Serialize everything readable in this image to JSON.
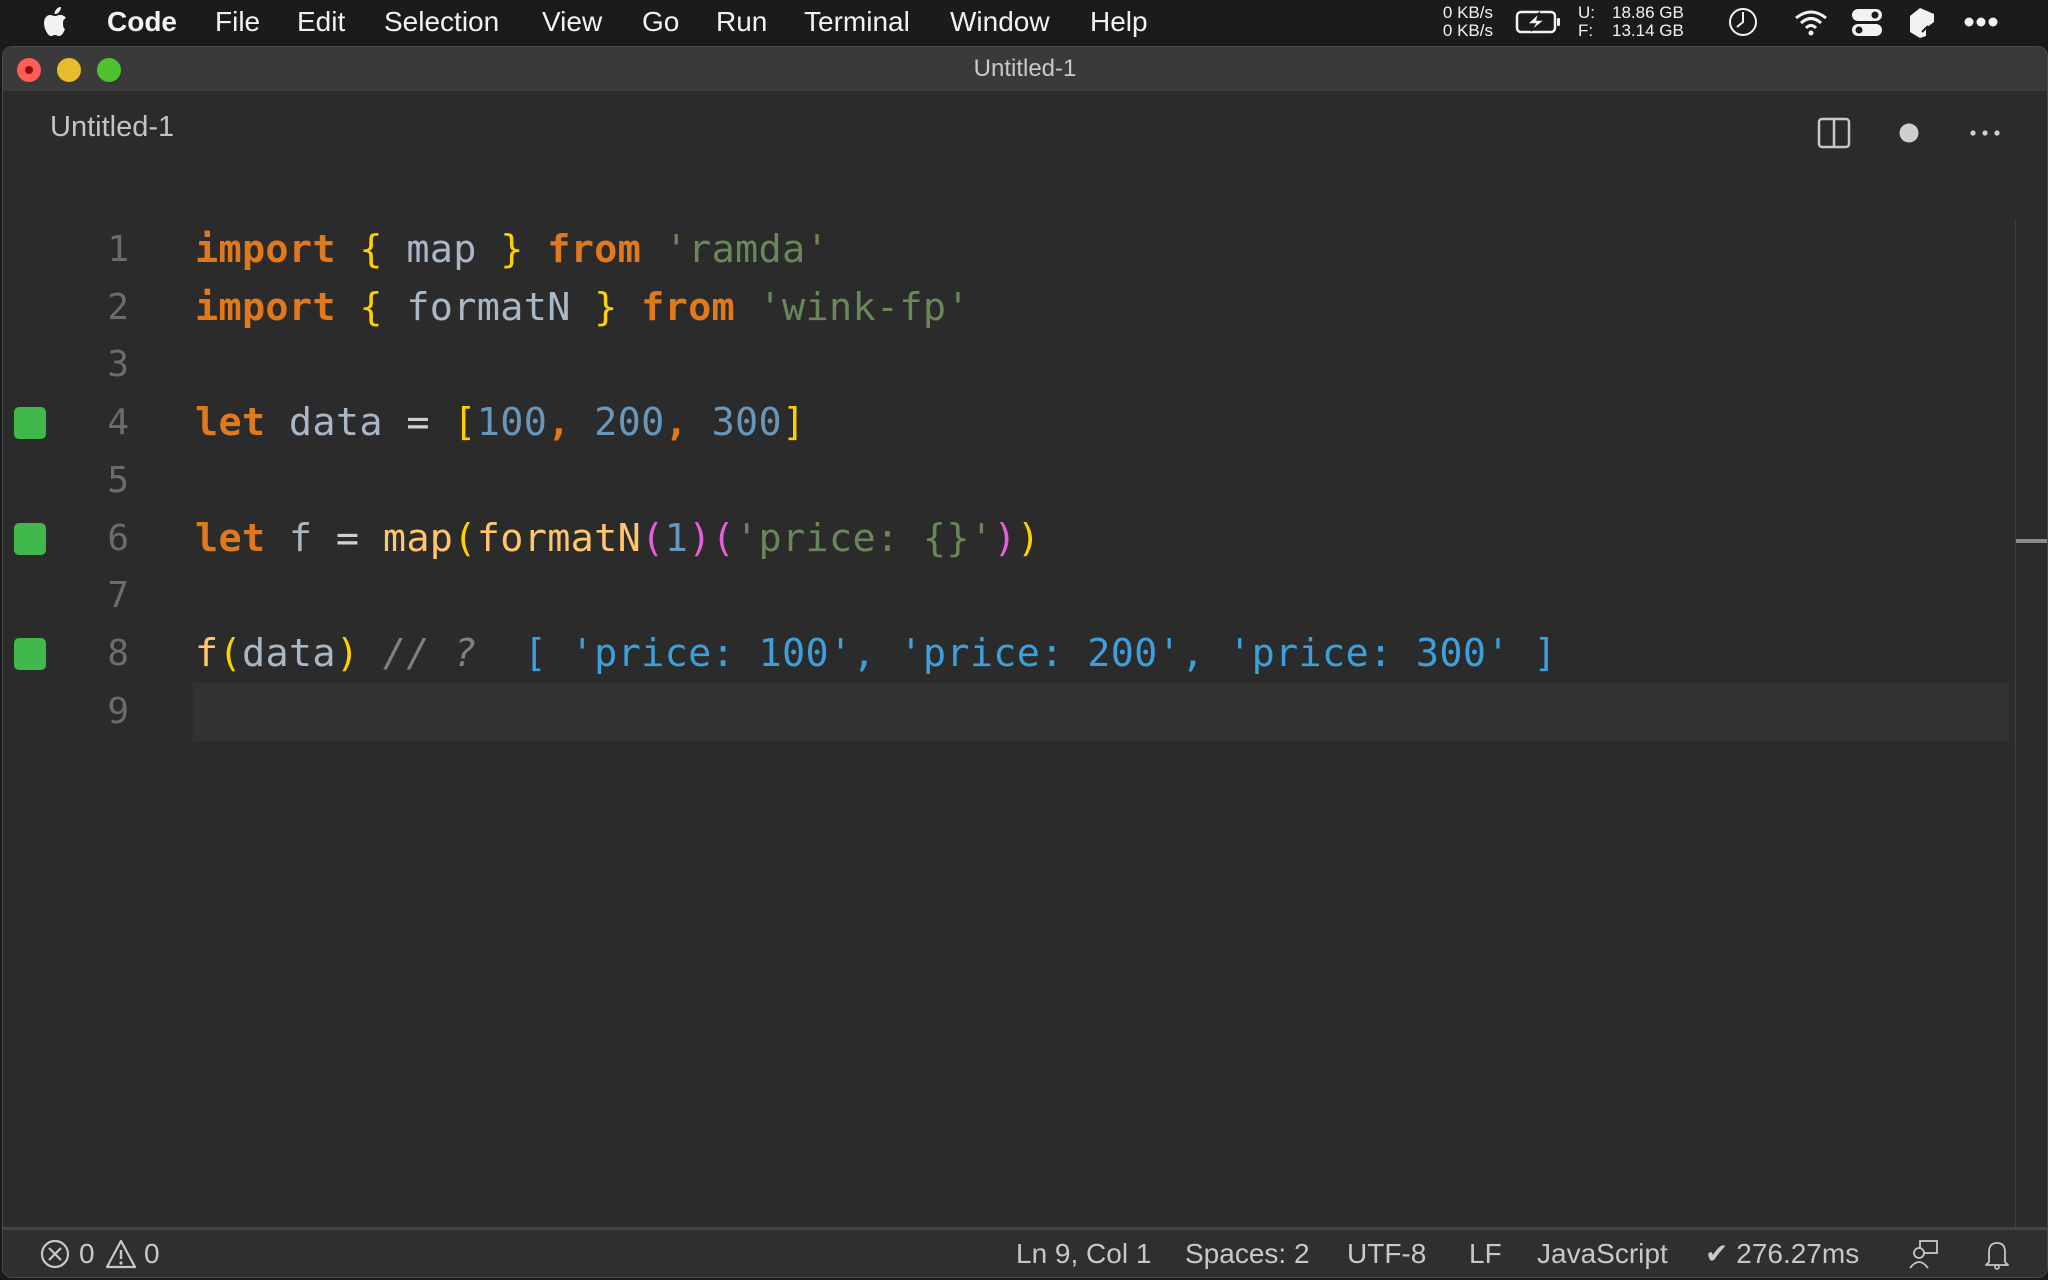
{
  "menubar": {
    "apple_icon": "apple-logo-icon",
    "app_name": "Code",
    "items": [
      "File",
      "Edit",
      "Selection",
      "View",
      "Go",
      "Run",
      "Terminal",
      "Window",
      "Help"
    ],
    "status": {
      "net_up": "0 KB/s",
      "net_down": "0 KB/s",
      "battery_icon": "battery-charging-icon",
      "disk_used_label": "U:",
      "disk_used": "18.86 GB",
      "disk_free_label": "F:",
      "disk_free": "13.14 GB",
      "clock_icon": "clock-icon",
      "wifi_icon": "wifi-icon",
      "control_center_icon": "control-center-icon",
      "extra_icon": "app-extension-icon",
      "more_icon": "more-icon"
    }
  },
  "window": {
    "title": "Untitled-1"
  },
  "tab": {
    "label": "Untitled-1",
    "actions": [
      "split-editor",
      "unsaved-dot",
      "more-actions"
    ]
  },
  "editor": {
    "line_numbers": [
      "1",
      "2",
      "3",
      "4",
      "5",
      "6",
      "7",
      "8",
      "9"
    ],
    "gutter_marks": [
      4,
      6,
      8
    ],
    "current_line": 9,
    "lines": [
      [
        {
          "t": "import",
          "c": "kw"
        },
        {
          "t": " ",
          "c": "op"
        },
        {
          "t": "{",
          "c": "br"
        },
        {
          "t": " map ",
          "c": "id"
        },
        {
          "t": "}",
          "c": "br"
        },
        {
          "t": " ",
          "c": "op"
        },
        {
          "t": "from",
          "c": "kw"
        },
        {
          "t": " ",
          "c": "op"
        },
        {
          "t": "'ramda'",
          "c": "str"
        }
      ],
      [
        {
          "t": "import",
          "c": "kw"
        },
        {
          "t": " ",
          "c": "op"
        },
        {
          "t": "{",
          "c": "br"
        },
        {
          "t": " formatN ",
          "c": "id"
        },
        {
          "t": "}",
          "c": "br"
        },
        {
          "t": " ",
          "c": "op"
        },
        {
          "t": "from",
          "c": "kw"
        },
        {
          "t": " ",
          "c": "op"
        },
        {
          "t": "'wink-fp'",
          "c": "str"
        }
      ],
      [],
      [
        {
          "t": "let",
          "c": "kw"
        },
        {
          "t": " data ",
          "c": "id"
        },
        {
          "t": "=",
          "c": "op"
        },
        {
          "t": " ",
          "c": "op"
        },
        {
          "t": "[",
          "c": "br"
        },
        {
          "t": "100",
          "c": "num"
        },
        {
          "t": ", ",
          "c": "kw"
        },
        {
          "t": "200",
          "c": "num"
        },
        {
          "t": ", ",
          "c": "kw"
        },
        {
          "t": "300",
          "c": "num"
        },
        {
          "t": "]",
          "c": "br"
        }
      ],
      [],
      [
        {
          "t": "let",
          "c": "kw"
        },
        {
          "t": " f ",
          "c": "id"
        },
        {
          "t": "=",
          "c": "op"
        },
        {
          "t": " ",
          "c": "op"
        },
        {
          "t": "map",
          "c": "fn"
        },
        {
          "t": "(",
          "c": "br"
        },
        {
          "t": "formatN",
          "c": "fn"
        },
        {
          "t": "(",
          "c": "br2"
        },
        {
          "t": "1",
          "c": "num"
        },
        {
          "t": ")",
          "c": "br2"
        },
        {
          "t": "(",
          "c": "br2"
        },
        {
          "t": "'price: {}'",
          "c": "str"
        },
        {
          "t": ")",
          "c": "br2"
        },
        {
          "t": ")",
          "c": "br"
        }
      ],
      [],
      [
        {
          "t": "f",
          "c": "fn"
        },
        {
          "t": "(",
          "c": "br"
        },
        {
          "t": "data",
          "c": "id"
        },
        {
          "t": ")",
          "c": "br"
        },
        {
          "t": " // ? ",
          "c": "cmt"
        },
        {
          "t": " [ 'price: 100', 'price: 200', 'price: 300' ]",
          "c": "res"
        }
      ],
      []
    ]
  },
  "statusbar": {
    "errors": "0",
    "warnings": "0",
    "cursor": "Ln 9, Col 1",
    "indent": "Spaces: 2",
    "encoding": "UTF-8",
    "eol": "LF",
    "language": "JavaScript",
    "timing": "✔ 276.27ms"
  },
  "colors": {
    "editor_bg": "#2b2b2b",
    "gutter_mark": "#3fb94c",
    "keyword": "#e0781e",
    "string": "#6a8759",
    "number": "#6897bb",
    "result": "#3d9fdb"
  }
}
